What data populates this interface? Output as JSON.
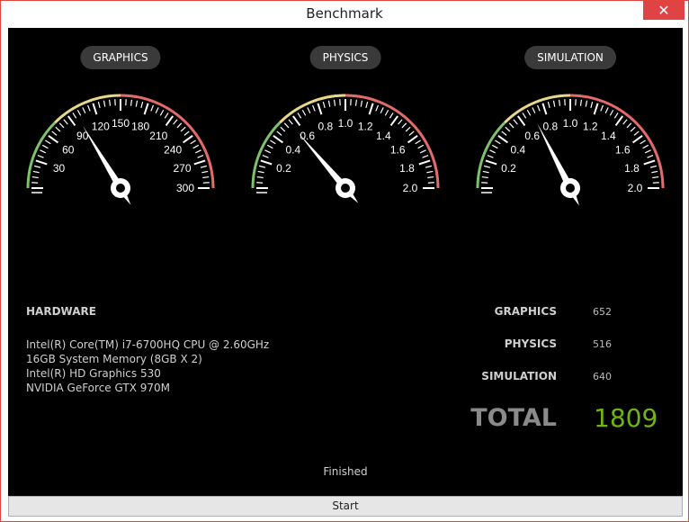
{
  "window": {
    "title": "Benchmark",
    "close_glyph": "✕"
  },
  "gauges": [
    {
      "label": "GRAPHICS",
      "ticks": [
        "30",
        "60",
        "90",
        "120",
        "150",
        "180",
        "210",
        "240",
        "270",
        "300"
      ],
      "max": 300,
      "needle_value": 98
    },
    {
      "label": "PHYSICS",
      "ticks": [
        "0.2",
        "0.4",
        "0.6",
        "0.8",
        "1.0",
        "1.2",
        "1.4",
        "1.6",
        "1.8",
        "2.0"
      ],
      "max": 2.0,
      "needle_value": 0.55
    },
    {
      "label": "SIMULATION",
      "ticks": [
        "0.2",
        "0.4",
        "0.6",
        "0.8",
        "1.0",
        "1.2",
        "1.4",
        "1.6",
        "1.8",
        "2.0"
      ],
      "max": 2.0,
      "needle_value": 0.7
    }
  ],
  "hardware": {
    "title": "HARDWARE",
    "lines": [
      "Intel(R) Core(TM) i7-6700HQ CPU @ 2.60GHz",
      "16GB System Memory (8GB X 2)",
      "Intel(R) HD Graphics 530",
      "NVIDIA GeForce GTX 970M"
    ]
  },
  "scores": [
    {
      "label": "GRAPHICS",
      "value": "652"
    },
    {
      "label": "PHYSICS",
      "value": "516"
    },
    {
      "label": "SIMULATION",
      "value": "640"
    }
  ],
  "total": {
    "label": "TOTAL",
    "value": "1809"
  },
  "status": "Finished",
  "start_label": "Start",
  "colors": {
    "arc_green": "#7fc16a",
    "arc_yellow": "#e8d88a",
    "arc_red": "#e36b6b",
    "total_value": "#6fb317"
  }
}
